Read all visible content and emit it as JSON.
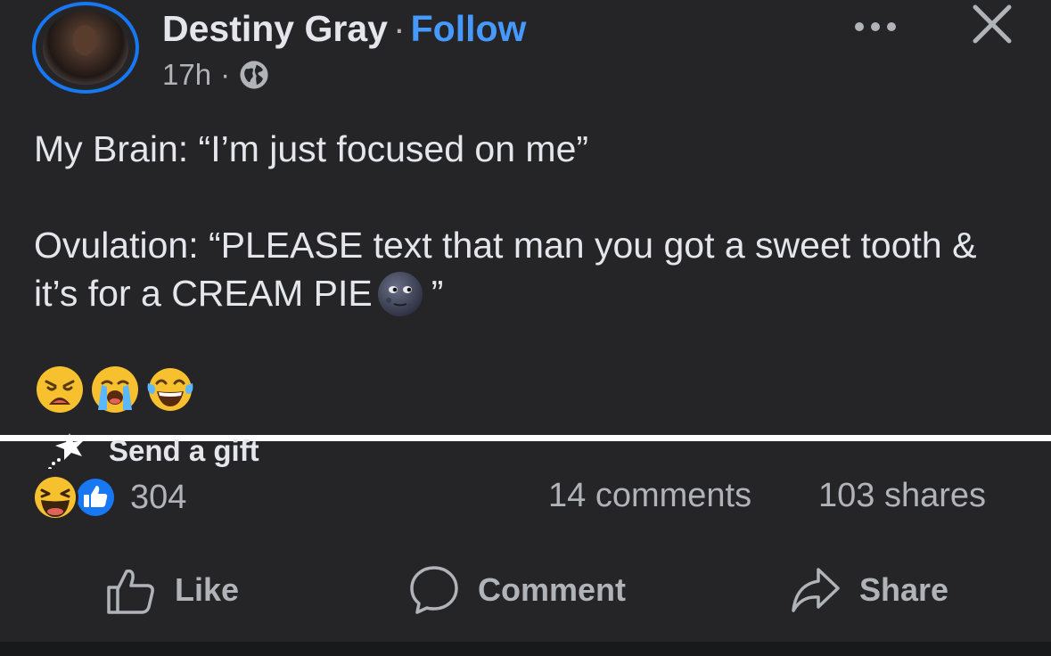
{
  "post": {
    "author": "Destiny Gray",
    "separator": "·",
    "follow_label": "Follow",
    "time": "17h",
    "time_separator": "·",
    "audience_icon": "globe-icon",
    "text_line1": "My Brain: “I’m just focused on me”",
    "text_line2": "Ovulation: “PLEASE text that man you got a sweet tooth & it’s for a CREAM PIE",
    "text_line2_close": "”",
    "trailing_emojis": [
      "weary-face-icon",
      "loudly-crying-face-icon",
      "face-with-tears-of-joy-icon"
    ]
  },
  "gift": {
    "label": "Send a gift"
  },
  "stats": {
    "reaction_count": "304",
    "comments": "14 comments",
    "shares": "103 shares"
  },
  "actions": {
    "like": "Like",
    "comment": "Comment",
    "share": "Share"
  },
  "colors": {
    "background": "#252527",
    "accent": "#1877f2",
    "follow": "#4599ff",
    "text": "#e4e6eb",
    "muted": "#b0b3b8"
  }
}
